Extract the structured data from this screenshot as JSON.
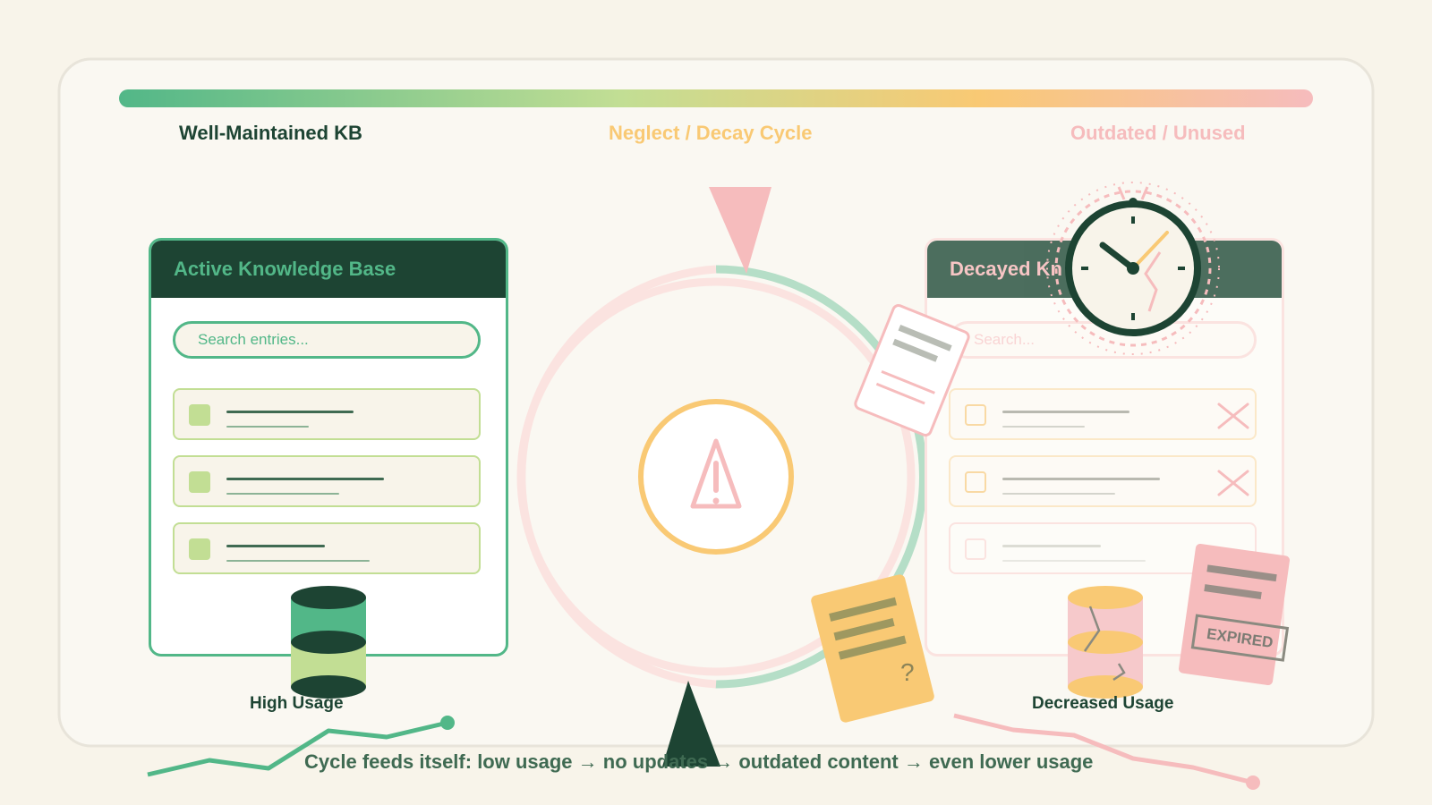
{
  "stage_labels": {
    "left": "Well-Maintained KB",
    "center": "Neglect / Decay Cycle",
    "right": "Outdated / Unused"
  },
  "active_panel": {
    "title": "Active Knowledge Base",
    "search_placeholder": "Search entries...",
    "usage_label": "High Usage"
  },
  "decayed_panel": {
    "title": "Decayed Kn",
    "search_placeholder": "Search...",
    "usage_label": "Decreased Usage"
  },
  "documents": {
    "unclear_mark": "?",
    "expired_stamp": "EXPIRED"
  },
  "caption": "Cycle feeds itself: low usage → no updates → outdated content → even lower usage",
  "colors": {
    "dark_green": "#1d4433",
    "green": "#52b788",
    "light_green": "#c2de94",
    "amber": "#f9c974",
    "pink": "#f6bcbd",
    "cream": "#f8f4ea"
  },
  "icons": [
    "warning-icon",
    "clock-icon",
    "database-icon",
    "document-icon",
    "close-icon"
  ]
}
